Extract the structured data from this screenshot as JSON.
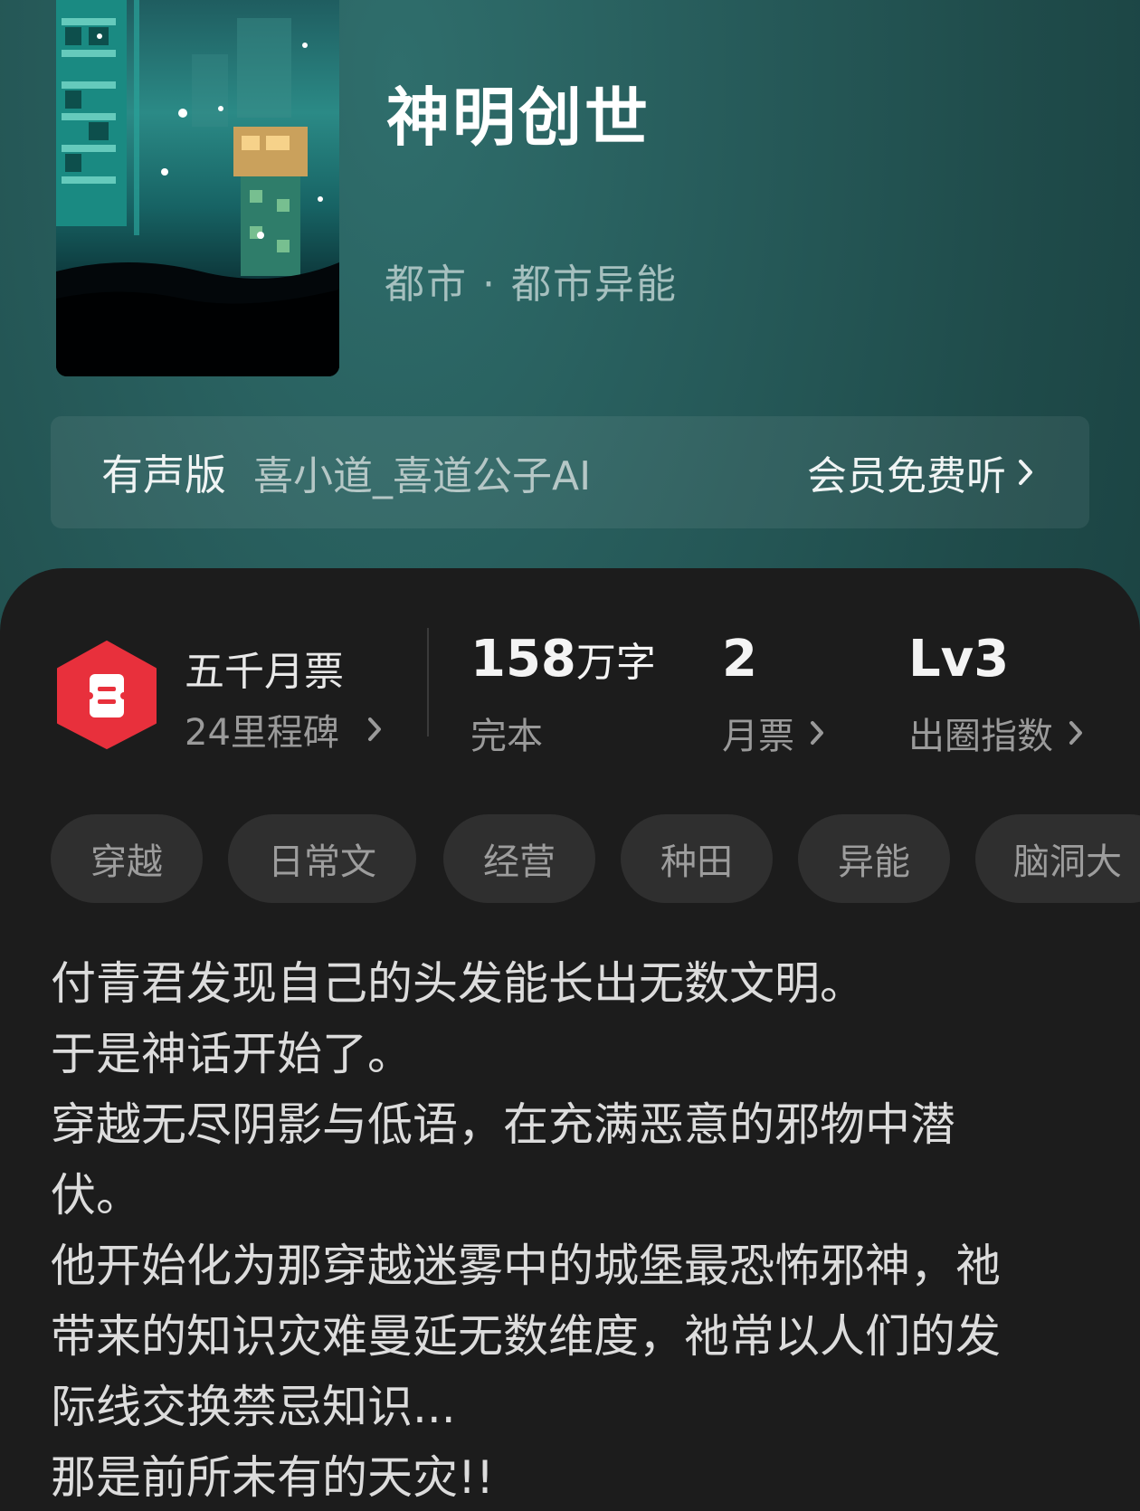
{
  "book": {
    "title": "神明创世",
    "category": "都市 · 都市异能"
  },
  "audio": {
    "label": "有声版",
    "narrator": "喜小道_喜道公子AI",
    "cta": "会员免费听"
  },
  "stats": {
    "milestone": {
      "name": "五千月票",
      "sub": "24里程碑"
    },
    "words": {
      "value": "158",
      "unit": "万字",
      "status": "完本"
    },
    "tickets": {
      "value": "2",
      "label": "月票"
    },
    "level": {
      "value": "Lv3",
      "label": "出圈指数"
    }
  },
  "tags": [
    "穿越",
    "日常文",
    "经营",
    "种田",
    "异能",
    "脑洞大"
  ],
  "description": [
    "付青君发现自己的头发能长出无数文明。",
    "于是神话开始了。",
    "穿越无尽阴影与低语，在充满恶意的邪物中潜",
    "伏。",
    "他开始化为那穿越迷雾中的城堡最恐怖邪神，祂",
    "带来的知识灾难曼延无数维度，祂常以人们的发",
    "际线交换禁忌知识...",
    "那是前所未有的天灾!!"
  ],
  "icons": {
    "badge": "ticket-badge-icon",
    "chevron": "chevron-right-icon"
  },
  "colors": {
    "header_bg": "#275c5b",
    "panel_bg": "#1c1c1c",
    "badge_red": "#e8303c",
    "tag_bg": "#2f2f2f"
  }
}
